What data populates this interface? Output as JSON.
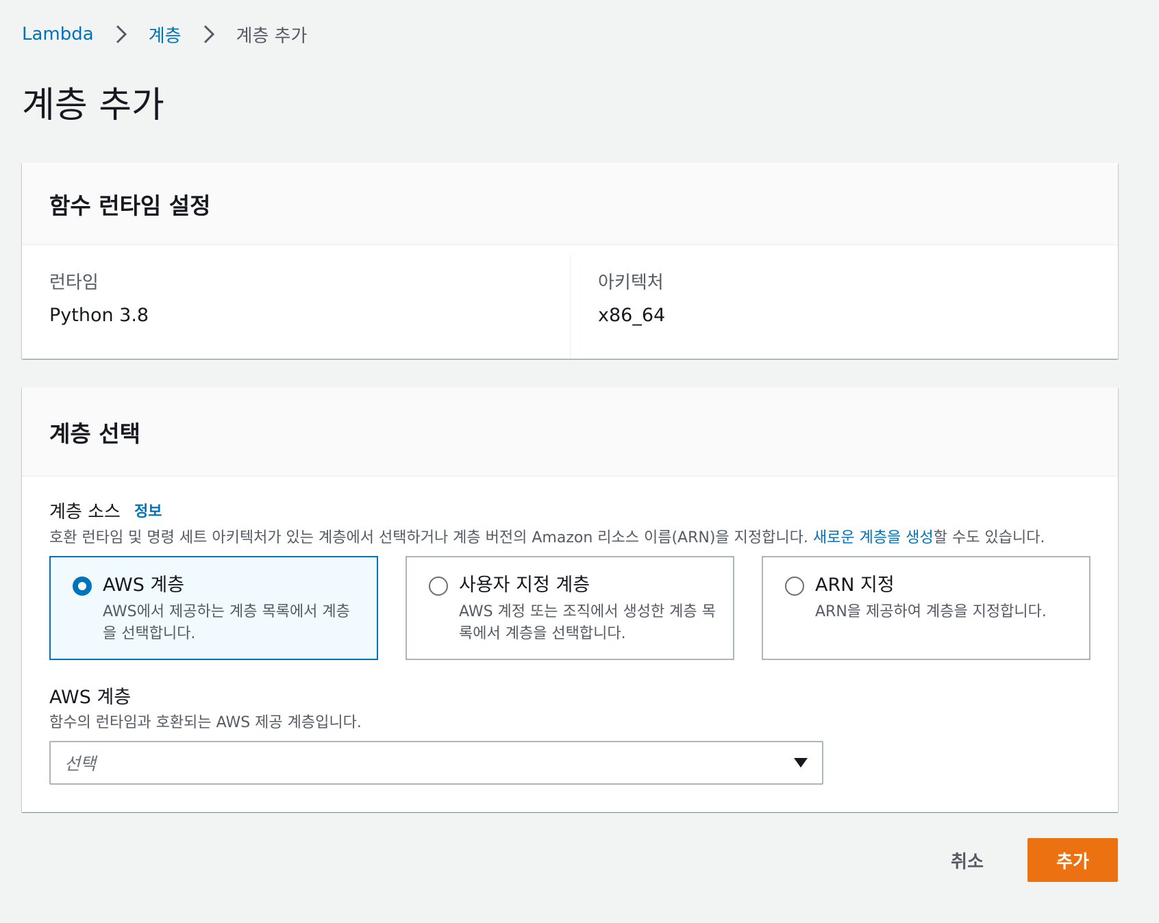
{
  "breadcrumb": {
    "items": [
      "Lambda",
      "계층",
      "계층 추가"
    ]
  },
  "page": {
    "title": "계층 추가"
  },
  "runtime_panel": {
    "title": "함수 런타임 설정",
    "runtime_label": "런타임",
    "runtime_value": "Python 3.8",
    "architecture_label": "아키텍처",
    "architecture_value": "x86_64"
  },
  "layer_panel": {
    "title": "계층 선택",
    "source_label": "계층 소스",
    "info_link": "정보",
    "source_desc_before": "호환 런타임 및 명령 세트 아키텍처가 있는 계층에서 선택하거나 계층 버전의 Amazon 리소스 이름(ARN)을 지정합니다. ",
    "source_desc_link": "새로운 계층을 생성",
    "source_desc_after": "할 수도 있습니다.",
    "tiles": [
      {
        "title": "AWS 계층",
        "desc": "AWS에서 제공하는 계층 목록에서 계층을 선택합니다.",
        "selected": true
      },
      {
        "title": "사용자 지정 계층",
        "desc": "AWS 계정 또는 조직에서 생성한 계층 목록에서 계층을 선택합니다.",
        "selected": false
      },
      {
        "title": "ARN 지정",
        "desc": "ARN을 제공하여 계층을 지정합니다.",
        "selected": false
      }
    ],
    "aws_layer_label": "AWS 계층",
    "aws_layer_desc": "함수의 런타임과 호환되는 AWS 제공 계층입니다.",
    "select_placeholder": "선택"
  },
  "actions": {
    "cancel_label": "취소",
    "add_label": "추가"
  },
  "colors": {
    "link": "#0073bb",
    "primary_button": "#ec7211",
    "selected_tile_bg": "#f1faff"
  }
}
